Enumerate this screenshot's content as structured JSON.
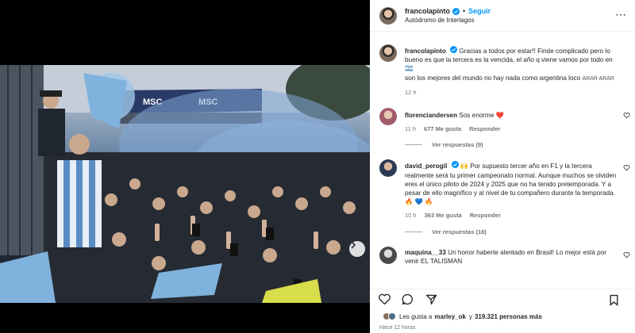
{
  "post": {
    "username": "francolapinto",
    "follow_label": "Seguir",
    "location": "Autódromo de Interlagos",
    "caption_username": "francolapinto",
    "caption_line1": "Gracias a todos por estar!! Finde complicado pero lo bueno es que la tercera es la vencida, el año q viene vamos por todo en",
    "caption_flag": "🇦🇷",
    "caption_line2": "son los mejores del mundo no hay nada como argentina loco",
    "caption_hashtag": "ARAR ARAR",
    "caption_time": "12 h"
  },
  "comments": [
    {
      "username": "florenciandersen",
      "text": "Sos enorme",
      "emoji": "❤️",
      "time": "11 h",
      "likes": "677 Me gusta",
      "reply_label": "Responder",
      "view_replies": "Ver respuestas (9)"
    },
    {
      "username": "david_perogil",
      "emoji_lead": "🙌",
      "text": "Por supuesto tercer año en F1 y la tercera realmente será tu primer campeonato normal. Aunque muchos se olviden eres el único piloto de 2024 y 2025 que no ha tenido pretemporada. Y a pesar de ello magnífico y al nivel de tu compañero durante la temporada.",
      "emoji_tail": "🔥 💙 🔥",
      "time": "10 h",
      "likes": "363 Me gusta",
      "reply_label": "Responder",
      "view_replies": "Ver respuestas (18)"
    },
    {
      "username": "maquina__33",
      "text": "Un honor haberte alentado en Brasil! Lo mejor está por venir",
      "extra": "EL TALISMAN"
    }
  ],
  "footer": {
    "likes_prefix": "Les gusta a",
    "likes_user": "marley_ok",
    "likes_mid": "y",
    "likes_count": "319.321 personas más",
    "time_ago": "Hace 12 horas"
  },
  "colors": {
    "accent": "#0095f6",
    "verified": "#0095f6",
    "heart": "#ff3040"
  }
}
